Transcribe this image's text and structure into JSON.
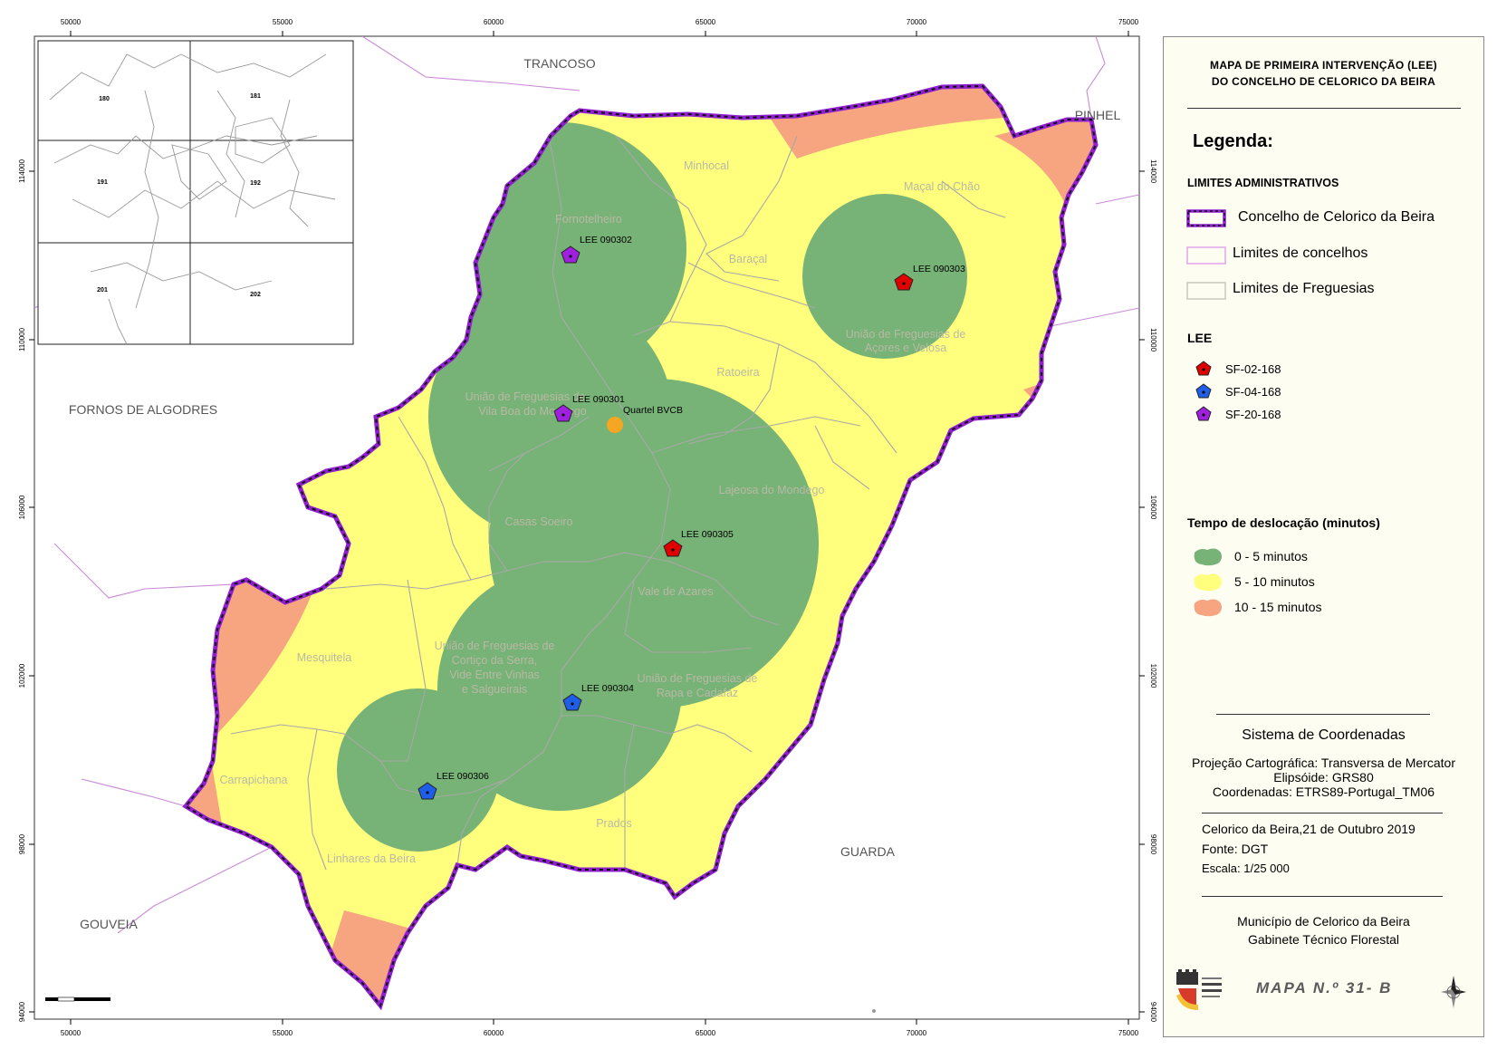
{
  "map": {
    "x_ticks": [
      "50000",
      "55000",
      "60000",
      "65000",
      "70000",
      "75000"
    ],
    "y_ticks": [
      "114000",
      "110000",
      "106000",
      "102000",
      "98000",
      "94000"
    ],
    "neighbors": {
      "trancoso": "TRANCOSO",
      "pinhel": "PINHEL",
      "fornos": "FORNOS DE ALGODRES",
      "guarda": "GUARDA",
      "gouveia": "GOUVEIA"
    },
    "parishes": {
      "fornotelheiro": "Fornotelheiro",
      "minhocal": "Minhocal",
      "macal": "Maçal do Chão",
      "baracal": "Baraçal",
      "acores_1": "União de Freguesias de",
      "acores_2": "Açores e Velosa",
      "ratoeira": "Ratoeira",
      "vilaboa_1": "União de Freguesias de",
      "vilaboa_2": "Vila Boa do Mondego",
      "lajeosa": "Lajeosa do Mondego",
      "casas": "Casas Soeiro",
      "vale": "Vale de Azares",
      "mesquitela": "Mesquitela",
      "cortico_1": "União de Freguesias de",
      "cortico_2": "Cortiço da Serra,",
      "cortico_3": "Vide Entre Vinhas",
      "cortico_4": "e Salgueirais",
      "rapa_1": "União de Freguesias de",
      "rapa_2": "Rapa e Cadafaz",
      "carrapichana": "Carrapichana",
      "prados": "Prados",
      "linhares": "Linhares da Beira"
    },
    "points": {
      "lee_090302": "LEE 090302",
      "lee_090303": "LEE 090303",
      "lee_090301": "LEE 090301",
      "quartel": "Quartel BVCB",
      "lee_090305": "LEE 090305",
      "lee_090304": "LEE 090304",
      "lee_090306": "LEE 090306"
    },
    "inset_labels": {
      "s180": "180",
      "s181": "181",
      "s191": "191",
      "s192": "192",
      "s201": "201",
      "s202": "202"
    },
    "colors": {
      "zone_0_5": "#77b276",
      "zone_5_10": "#ffff7d",
      "zone_10_15": "#f7a580",
      "boundary": "#8f1fd0",
      "sf02": "#e00000",
      "sf04": "#1f5ee8",
      "sf20": "#a020e0",
      "quartel": "#f5a623"
    }
  },
  "legend": {
    "title_1": "MAPA DE PRIMEIRA INTERVENÇÃO (LEE)",
    "title_2": "DO CONCELHO DE CELORICO DA BEIRA",
    "heading": "Legenda:",
    "admin_section": "LIMITES ADMINISTRATIVOS",
    "admin_concelho": "Concelho de Celorico da Beira",
    "admin_concelhos": "Limites de concelhos",
    "admin_freguesias": "Limites de Freguesias",
    "lee_section": "LEE",
    "lee_sf02": "SF-02-168",
    "lee_sf04": "SF-04-168",
    "lee_sf20": "SF-20-168",
    "time_section": "Tempo de deslocação (minutos)",
    "time_0_5": "0 - 5 minutos",
    "time_5_10": "5 - 10 minutos",
    "time_10_15": "10 - 15 minutos"
  },
  "coords": {
    "title": "Sistema de Coordenadas",
    "projection": "Projeção Cartográfica: Transversa de Mercator",
    "ellipsoid": "Elipsóide: GRS80",
    "coordinates": "Coordenadas: ETRS89-Portugal_TM06"
  },
  "info": {
    "place_date": "Celorico da Beira,21 de Outubro 2019",
    "source": "Fonte: DGT",
    "scale": "Escala: 1/25 000"
  },
  "credits": {
    "municipality": "Município de Celorico da Beira",
    "office": "Gabinete Técnico Florestal",
    "map_number": "MAPA N.º 31- B"
  }
}
